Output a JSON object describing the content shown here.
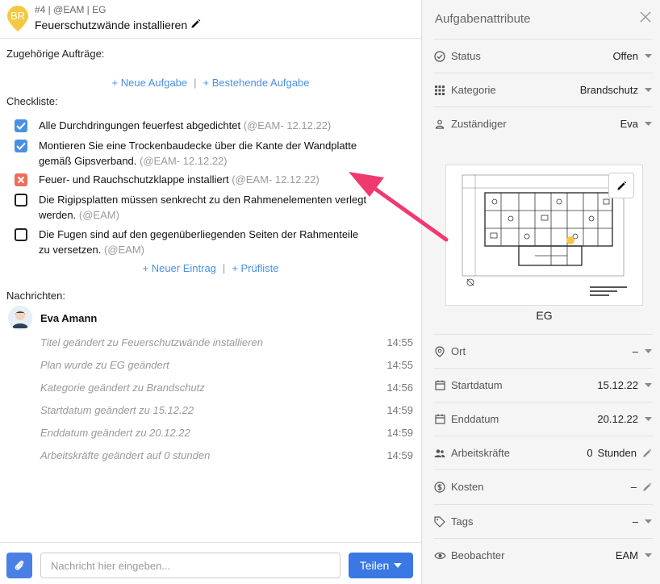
{
  "header": {
    "pin_initials": "BR",
    "meta": "#4 | @EAM | EG",
    "title": "Feuerschutzwände installieren"
  },
  "related": {
    "label": "Zugehörige Aufträge:",
    "new_task": "+ Neue Aufgabe",
    "separator": "|",
    "existing_task": "+ Bestehende Aufgabe"
  },
  "checklist": {
    "label": "Checkliste:",
    "items": [
      {
        "state": "checked",
        "text": "Alle Durchdringungen feuerfest abgedichtet",
        "meta": "(@EAM- 12.12.22)"
      },
      {
        "state": "checked",
        "text": "Montieren Sie eine Trockenbaudecke über die Kante der Wandplatte gemäß Gipsverband.",
        "meta": "(@EAM- 12.12.22)"
      },
      {
        "state": "failed",
        "text": "Feuer- und Rauchschutzklappe installiert",
        "meta": "(@EAM- 12.12.22)"
      },
      {
        "state": "empty",
        "text": "Die Rigipsplatten müssen senkrecht zu den Rahmenelementen verlegt werden.",
        "meta": "(@EAM)"
      },
      {
        "state": "empty",
        "text": "Die Fugen sind auf den gegenüberliegenden Seiten der Rahmenteile zu versetzen.",
        "meta": "(@EAM)"
      }
    ],
    "new_entry": "+ Neuer Eintrag",
    "separator": "|",
    "checklist_link": "+ Prüfliste"
  },
  "messages": {
    "label": "Nachrichten:",
    "user": "Eva Amann",
    "items": [
      {
        "text": "Titel geändert zu Feuerschutzwände installieren",
        "time": "14:55"
      },
      {
        "text": "Plan wurde zu EG geändert",
        "time": "14:55"
      },
      {
        "text": "Kategorie geändert zu Brandschutz",
        "time": "14:56"
      },
      {
        "text": "Startdatum geändert zu 15.12.22",
        "time": "14:59"
      },
      {
        "text": "Enddatum geändert zu 20.12.22",
        "time": "14:59"
      },
      {
        "text": "Arbeitskräfte geändert auf 0 stunden",
        "time": "14:59"
      }
    ]
  },
  "footer": {
    "input_placeholder": "Nachricht hier eingeben...",
    "share_label": "Teilen"
  },
  "panel": {
    "title": "Aufgabenattribute",
    "status": {
      "label": "Status",
      "value": "Offen"
    },
    "category": {
      "label": "Kategorie",
      "value": "Brandschutz"
    },
    "assignee": {
      "label": "Zuständiger",
      "value": "Eva"
    },
    "plan_label": "EG",
    "location": {
      "label": "Ort",
      "value": "–"
    },
    "start": {
      "label": "Startdatum",
      "value": "15.12.22"
    },
    "end": {
      "label": "Enddatum",
      "value": "20.12.22"
    },
    "workers": {
      "label": "Arbeitskräfte",
      "value": "0",
      "unit": "Stunden"
    },
    "costs": {
      "label": "Kosten",
      "value": "–"
    },
    "tags": {
      "label": "Tags",
      "value": "–"
    },
    "watchers": {
      "label": "Beobachter",
      "value": "EAM"
    }
  },
  "colors": {
    "accent": "#4a90e2",
    "pin": "#f5c842",
    "failed": "#ec6d5a",
    "arrow": "#f0396f"
  }
}
